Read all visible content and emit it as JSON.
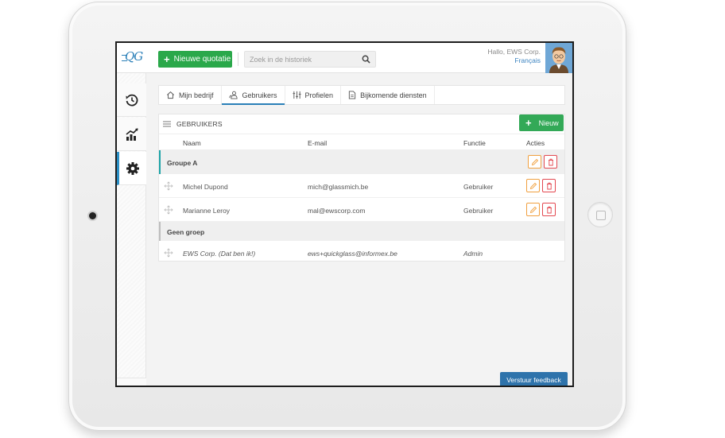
{
  "app": {
    "logo_text": "QG"
  },
  "topbar": {
    "new_quote_label": "Nieuwe quotatie",
    "search_placeholder": "Zoek in de historiek",
    "greeting": "Hallo, EWS Corp.",
    "language": "Français"
  },
  "sidebar": {
    "items": [
      {
        "icon": "history-icon"
      },
      {
        "icon": "chart-icon"
      },
      {
        "icon": "gear-icon",
        "active": true
      }
    ],
    "help_label": "?"
  },
  "tabs": [
    {
      "label": "Mijn bedrijf",
      "icon": "home-icon"
    },
    {
      "label": "Gebruikers",
      "icon": "users-icon",
      "active": true
    },
    {
      "label": "Profielen",
      "icon": "sliders-icon"
    },
    {
      "label": "Bijkomende diensten",
      "icon": "document-icon"
    }
  ],
  "users_panel": {
    "title": "GEBRUIKERS",
    "new_label": "Nieuw",
    "columns": {
      "name": "Naam",
      "email": "E-mail",
      "function": "Functie",
      "actions": "Acties"
    },
    "groups": [
      {
        "name": "Groupe A",
        "users": [
          {
            "name": "Michel Dupond",
            "email": "mich@glassmich.be",
            "function": "Gebruiker"
          },
          {
            "name": "Marianne Leroy",
            "email": "mal@ewscorp.com",
            "function": "Gebruiker"
          }
        ]
      },
      {
        "name": "Geen groep",
        "users": [
          {
            "name": "EWS Corp. (Dat ben ik!)",
            "email": "ews+quickglass@informex.be",
            "function": "Admin"
          }
        ]
      }
    ]
  },
  "feedback_label": "Verstuur feedback",
  "colors": {
    "primary_green": "#2aa84a",
    "accent_blue": "#2a7fb8",
    "teal": "#1da4a8",
    "edit_orange": "#f0a040",
    "delete_red": "#e34850"
  }
}
